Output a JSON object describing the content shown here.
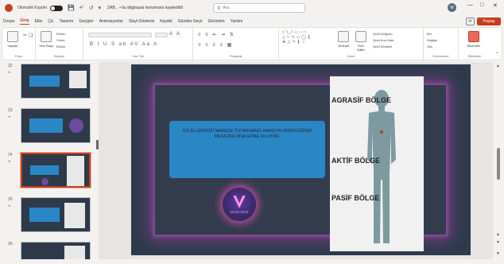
{
  "titlebar": {
    "autosave_label": "Otomatik Kaydet",
    "autosave_state": "off",
    "doc_name": "ZAB... • bu bilgisayar konumuna kaydedildi",
    "search_placeholder": "Ara",
    "avatar_initials": "M"
  },
  "menu": {
    "items": [
      "Dosya",
      "Giriş",
      "Ekle",
      "Çiz",
      "Tasarım",
      "Geçişler",
      "Animasyonlar",
      "Slayt Gösterisi",
      "Kaydet",
      "Gözden Geçir",
      "Görünüm",
      "Yardım"
    ],
    "active": "Giriş",
    "share_label": "Paylaş"
  },
  "ribbon": {
    "groups": {
      "clipboard": "Pano",
      "slides": "Slaytlar",
      "font": "Yazı Tipi",
      "paragraph": "Paragraf",
      "drawing": "Çizim",
      "editing": "Düzenleme",
      "addins": "Eklentiler"
    },
    "paste_label": "Yapıştır",
    "new_slide_label": "Yeni Slayt",
    "layout_label": "Düzen",
    "reset_label": "Sıfırla",
    "section_label": "Bölüm",
    "arrange_label": "Yerleştir",
    "quick_styles_label": "Hızlı Stiller",
    "shape_fill_label": "Şekil Dolgusu",
    "shape_outline_label": "Şekil Ana Hattı",
    "shape_effects_label": "Şekil Efektleri",
    "find_label": "Bul",
    "replace_label": "Değiştir",
    "select_label": "Seç",
    "addins_label": "Eklentiler"
  },
  "thumbnails": [
    {
      "number": "22",
      "selected": false
    },
    {
      "number": "23",
      "selected": false
    },
    {
      "number": "24",
      "selected": true
    },
    {
      "number": "25",
      "selected": false
    },
    {
      "number": "26",
      "selected": false
    }
  ],
  "slide": {
    "text": "SİZ ELLERİNİZİ NEREDE TUTARSANIZ KARŞIYA VERECEĞİNİZ MESAJDA ONA GÖRE OLUYOR.",
    "logo_text": "AVCIR ATES",
    "zones": [
      "AGRASİF BÖLGE",
      "AKTİF BÖLGE",
      "PASİF BÖLGE"
    ]
  },
  "colors": {
    "accent": "#c43e1c",
    "slide_bg": "#2f3a4b",
    "text_box": "#2b86c5",
    "glow": "#7a3f8a"
  }
}
